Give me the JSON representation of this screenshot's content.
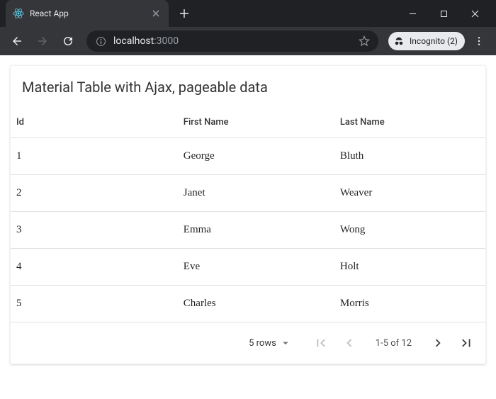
{
  "browser": {
    "tab_title": "React App",
    "url_host": "localhost",
    "url_port": ":3000",
    "incognito_label": "Incognito (2)"
  },
  "page": {
    "title": "Material Table with Ajax, pageable data"
  },
  "table": {
    "headers": [
      "Id",
      "First Name",
      "Last Name"
    ],
    "rows": [
      {
        "id": "1",
        "first": "George",
        "last": "Bluth"
      },
      {
        "id": "2",
        "first": "Janet",
        "last": "Weaver"
      },
      {
        "id": "3",
        "first": "Emma",
        "last": "Wong"
      },
      {
        "id": "4",
        "first": "Eve",
        "last": "Holt"
      },
      {
        "id": "5",
        "first": "Charles",
        "last": "Morris"
      }
    ]
  },
  "pagination": {
    "rows_label": "5 rows",
    "range_label": "1-5 of 12"
  }
}
